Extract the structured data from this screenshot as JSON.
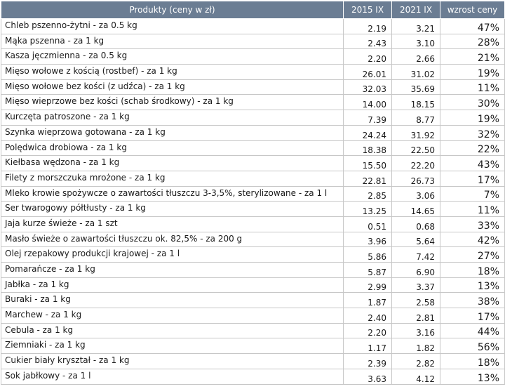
{
  "table": {
    "headers": {
      "product": "Produkty (ceny w zł)",
      "year_2015": "2015 IX",
      "year_2021": "2021 IX",
      "growth": "wzrost ceny"
    },
    "rows": [
      {
        "product": "Chleb pszenno-żytni - za 0.5 kg",
        "p2015": "2.19",
        "p2021": "3.21",
        "growth": "47%"
      },
      {
        "product": "Mąka pszenna - za 1 kg",
        "p2015": "2.43",
        "p2021": "3.10",
        "growth": "28%"
      },
      {
        "product": "Kasza jęczmienna - za 0.5 kg",
        "p2015": "2.20",
        "p2021": "2.66",
        "growth": "21%"
      },
      {
        "product": "Mięso wołowe z kością (rostbef) - za 1 kg",
        "p2015": "26.01",
        "p2021": "31.02",
        "growth": "19%"
      },
      {
        "product": "Mięso wołowe bez kości (z udźca) - za 1 kg",
        "p2015": "32.03",
        "p2021": "35.69",
        "growth": "11%"
      },
      {
        "product": "Mięso wieprzowe bez kości (schab środkowy) - za 1 kg",
        "p2015": "14.00",
        "p2021": "18.15",
        "growth": "30%"
      },
      {
        "product": "Kurczęta patroszone - za 1 kg",
        "p2015": "7.39",
        "p2021": "8.77",
        "growth": "19%"
      },
      {
        "product": "Szynka wieprzowa gotowana - za 1 kg",
        "p2015": "24.24",
        "p2021": "31.92",
        "growth": "32%"
      },
      {
        "product": "Polędwica drobiowa - za 1 kg",
        "p2015": "18.38",
        "p2021": "22.50",
        "growth": "22%"
      },
      {
        "product": "Kiełbasa wędzona - za 1 kg",
        "p2015": "15.50",
        "p2021": "22.20",
        "growth": "43%"
      },
      {
        "product": "Filety z morszczuka mrożone - za 1 kg",
        "p2015": "22.81",
        "p2021": "26.73",
        "growth": "17%"
      },
      {
        "product": "Mleko krowie spożywcze o zawartości tłuszczu 3-3,5%, sterylizowane - za 1 l",
        "p2015": "2.85",
        "p2021": "3.06",
        "growth": "7%"
      },
      {
        "product": "Ser twarogowy półtłusty - za 1 kg",
        "p2015": "13.25",
        "p2021": "14.65",
        "growth": "11%"
      },
      {
        "product": "Jaja kurze świeże - za 1 szt",
        "p2015": "0.51",
        "p2021": "0.68",
        "growth": "33%"
      },
      {
        "product": "Masło świeże o zawartości tłuszczu ok. 82,5% - za 200 g",
        "p2015": "3.96",
        "p2021": "5.64",
        "growth": "42%"
      },
      {
        "product": "Olej rzepakowy produkcji krajowej - za 1 l",
        "p2015": "5.86",
        "p2021": "7.42",
        "growth": "27%"
      },
      {
        "product": "Pomarańcze - za 1 kg",
        "p2015": "5.87",
        "p2021": "6.90",
        "growth": "18%"
      },
      {
        "product": "Jabłka - za 1 kg",
        "p2015": "2.99",
        "p2021": "3.37",
        "growth": "13%"
      },
      {
        "product": "Buraki - za 1 kg",
        "p2015": "1.87",
        "p2021": "2.58",
        "growth": "38%"
      },
      {
        "product": "Marchew - za 1 kg",
        "p2015": "2.40",
        "p2021": "2.81",
        "growth": "17%"
      },
      {
        "product": "Cebula - za 1 kg",
        "p2015": "2.20",
        "p2021": "3.16",
        "growth": "44%"
      },
      {
        "product": "Ziemniaki - za 1 kg",
        "p2015": "1.17",
        "p2021": "1.82",
        "growth": "56%"
      },
      {
        "product": "Cukier biały kryształ - za 1 kg",
        "p2015": "2.39",
        "p2021": "2.82",
        "growth": "18%"
      },
      {
        "product": "Sok jabłkowy - za 1 l",
        "p2015": "3.63",
        "p2021": "4.12",
        "growth": "13%"
      }
    ]
  },
  "colors": {
    "header_background": "#6b7d93",
    "header_text": "#ffffff",
    "grid_line": "#c7c7c7"
  }
}
